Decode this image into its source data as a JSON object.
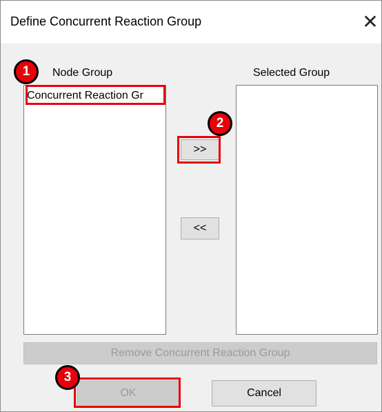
{
  "dialog": {
    "title": "Define Concurrent Reaction Group",
    "close_symbol": "✕"
  },
  "node_group": {
    "label": "Node Group",
    "items": [
      "Concurrent Reaction Gr"
    ]
  },
  "selected_group": {
    "label": "Selected Group",
    "items": []
  },
  "buttons": {
    "add": ">>",
    "remove_from": "<<",
    "remove_group": "Remove Concurrent Reaction Group",
    "ok": "OK",
    "cancel": "Cancel"
  },
  "annotations": {
    "step1": "1",
    "step2": "2",
    "step3": "3",
    "color": "#e8000b"
  },
  "icons": {
    "close": "close-icon"
  }
}
